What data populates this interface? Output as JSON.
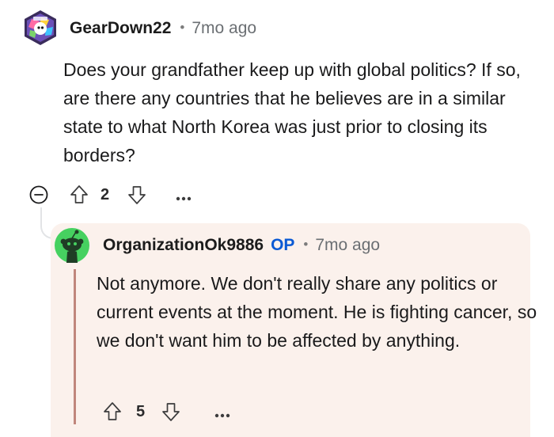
{
  "comment": {
    "author": "GearDown22",
    "separator": "•",
    "time_ago": "7mo ago",
    "body": "Does your grandfather keep up with global politics? If so, are there any countries that he believes are in a similar state to what North Korea was just prior to closing its borders?",
    "score": "2",
    "avatar_icon": "snoo-avatar-icon",
    "collapse_icon": "collapse-minus-icon",
    "upvote_icon": "upvote-arrow-icon",
    "downvote_icon": "downvote-arrow-icon",
    "more_icon": "more-options-icon"
  },
  "reply": {
    "author": "OrganizationOk9886",
    "op_badge": "OP",
    "separator": "•",
    "time_ago": "7mo ago",
    "body": "Not anymore. We don't really share any politics or current events at the moment. He is fighting cancer, so we don't want him to be affected by anything.",
    "score": "5",
    "avatar_icon": "snoo-avatar-icon",
    "highlight_background": "#fbf1ec",
    "accent_color": "#c0867c",
    "op_color": "#0b5ad4"
  }
}
